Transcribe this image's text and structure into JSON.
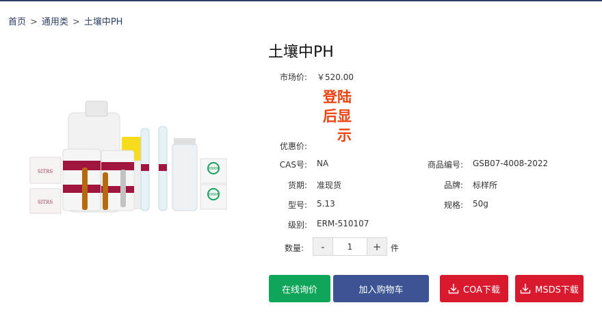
{
  "breadcrumb": {
    "items": [
      "首页",
      "通用类",
      "土壤中PH"
    ],
    "separator": ">"
  },
  "product": {
    "title": "土壤中PH",
    "market_price_label": "市场价:",
    "market_price": "￥520.00",
    "discount_price_label": "优惠价:",
    "login_notice": "登陆后显示",
    "cas_label": "CAS号:",
    "cas": "NA",
    "product_no_label": "商品编号:",
    "product_no": "GSB07-4008-2022",
    "delivery_label": "货期:",
    "delivery": "准现货",
    "brand_label": "品牌:",
    "brand": "标样所",
    "model_label": "型号:",
    "model": "5.13",
    "spec_label": "规格:",
    "spec": "50g",
    "grade_label": "级别:",
    "grade": "ERM-510107"
  },
  "image_labels": {
    "sitrs": "SITRS",
    "xbrm": "XBRM"
  },
  "quantity": {
    "label": "数量:",
    "minus": "-",
    "plus": "+",
    "value": "1",
    "unit": "件"
  },
  "actions": {
    "inquiry": "在线询价",
    "cart": "加入购物车",
    "coa": "COA下载",
    "msds": "MSDS下载"
  },
  "colors": {
    "accent_navy": "#2c3e63",
    "inquiry_green": "#0fa65a",
    "cart_blue": "#3d5494",
    "download_red": "#d9192d",
    "notice_orange": "#f0410c"
  }
}
